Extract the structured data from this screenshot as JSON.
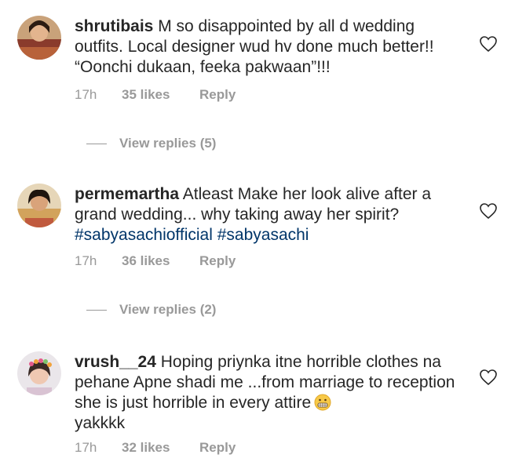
{
  "comments": [
    {
      "username": "shrutibais",
      "text": " M so disappointed by all d wedding outfits. Local designer wud hv done much better!! “Oonchi dukaan, feeka pakwaan”!!!",
      "time": "17h",
      "likes": "35 likes",
      "reply": "Reply",
      "view_replies": "View replies (5)"
    },
    {
      "username": "permemartha",
      "text": " Atleast Make her look alive after a grand wedding... why taking away her spirit? ",
      "hashtags": [
        "#sabyasachiofficial",
        "#sabyasachi"
      ],
      "time": "17h",
      "likes": "36 likes",
      "reply": "Reply",
      "view_replies": "View replies (2)"
    },
    {
      "username": "vrush__24",
      "text": " Hoping priynka itne horrible clothes na pehane Apne shadi me ...from marriage to reception she is just horrible in every attire",
      "text_after": "yakkkk",
      "emoji": "grimacing-face-emoji",
      "time": "17h",
      "likes": "32 likes",
      "reply": "Reply"
    }
  ],
  "colors": {
    "text": "#262626",
    "meta": "#999999",
    "hashtag": "#003569"
  }
}
